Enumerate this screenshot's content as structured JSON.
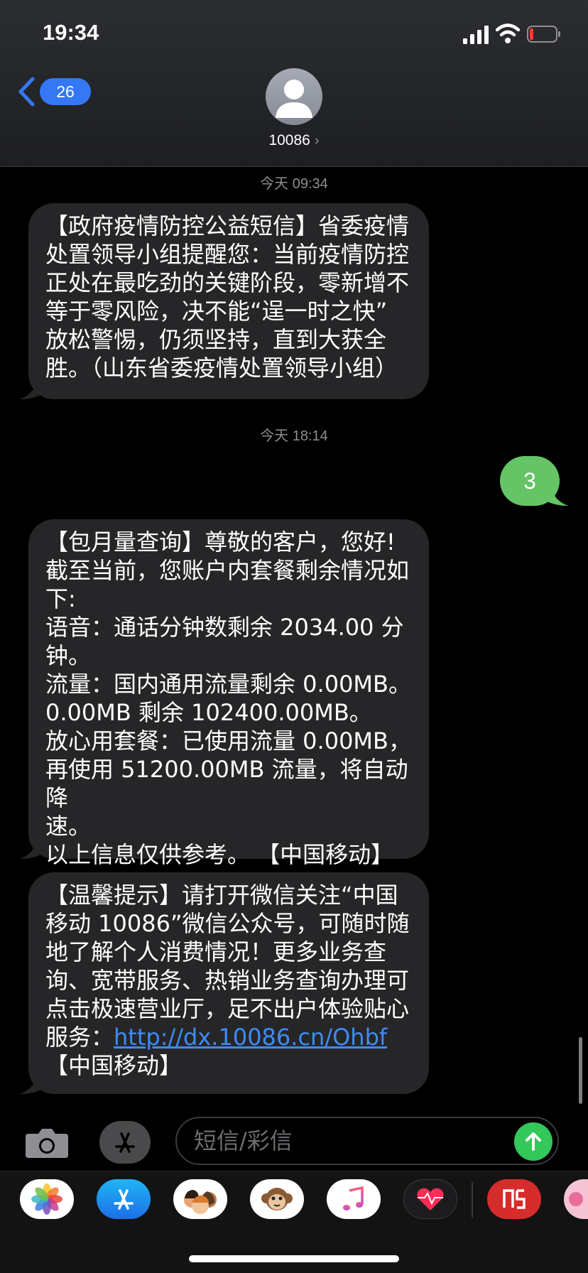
{
  "status_bar": {
    "time": "19:34"
  },
  "header": {
    "back_badge": "26",
    "contact_name": "10086",
    "contact_chevron": "›"
  },
  "messages": {
    "ts1": "今天 09:34",
    "m1": {
      "lines": [
        "【政府疫情防控公益短信】省委疫情",
        "处置领导小组提醒您：当前疫情防控",
        "正处在最吃劲的关键阶段，零新增不",
        "等于零风险，决不能“逞一时之快”",
        "放松警惕，仍须坚持，直到大获全",
        "胜。（山东省委疫情处置领导小组）"
      ]
    },
    "ts2": "今天 18:14",
    "sent": "3",
    "m2": {
      "lines": [
        "【包月量查询】尊敬的客户，您好!",
        "截至当前，您账户内套餐剩余情况如",
        "下:",
        "语音：通话分钟数剩余 2034.00 分",
        "钟。",
        "流量：国内通用流量剩余 0.00MB。",
        "0.00MB 剩余 102400.00MB。",
        "放心用套餐：已使用流量 0.00MB，",
        "再使用 51200.00MB 流量，将自动降",
        "速。",
        "以上信息仅供参考。 【中国移动】"
      ]
    },
    "m3": {
      "lines": [
        "【温馨提示】请打开微信关注“中国",
        "移动 10086”微信公众号，可随时随",
        "地了解个人消费情况！更多业务查",
        "询、宽带服务、热销业务查询办理可",
        "点击极速营业厅，足不出户体验贴心"
      ],
      "link_prefix": "服务：",
      "link": "http://dx.10086.cn/Ohbf",
      "footer": "【中国移动】"
    }
  },
  "input": {
    "placeholder": "短信/彩信"
  },
  "colors": {
    "sent_bubble": "#65c466",
    "received_bubble": "#262628",
    "accent": "#3478f6",
    "link": "#3d8cf7"
  },
  "apps": [
    "photos-icon",
    "app-store-icon",
    "memoji-icon",
    "animoji-monkey-icon",
    "music-icon",
    "digital-touch-icon",
    "app-icon",
    "app-icon-partial"
  ]
}
